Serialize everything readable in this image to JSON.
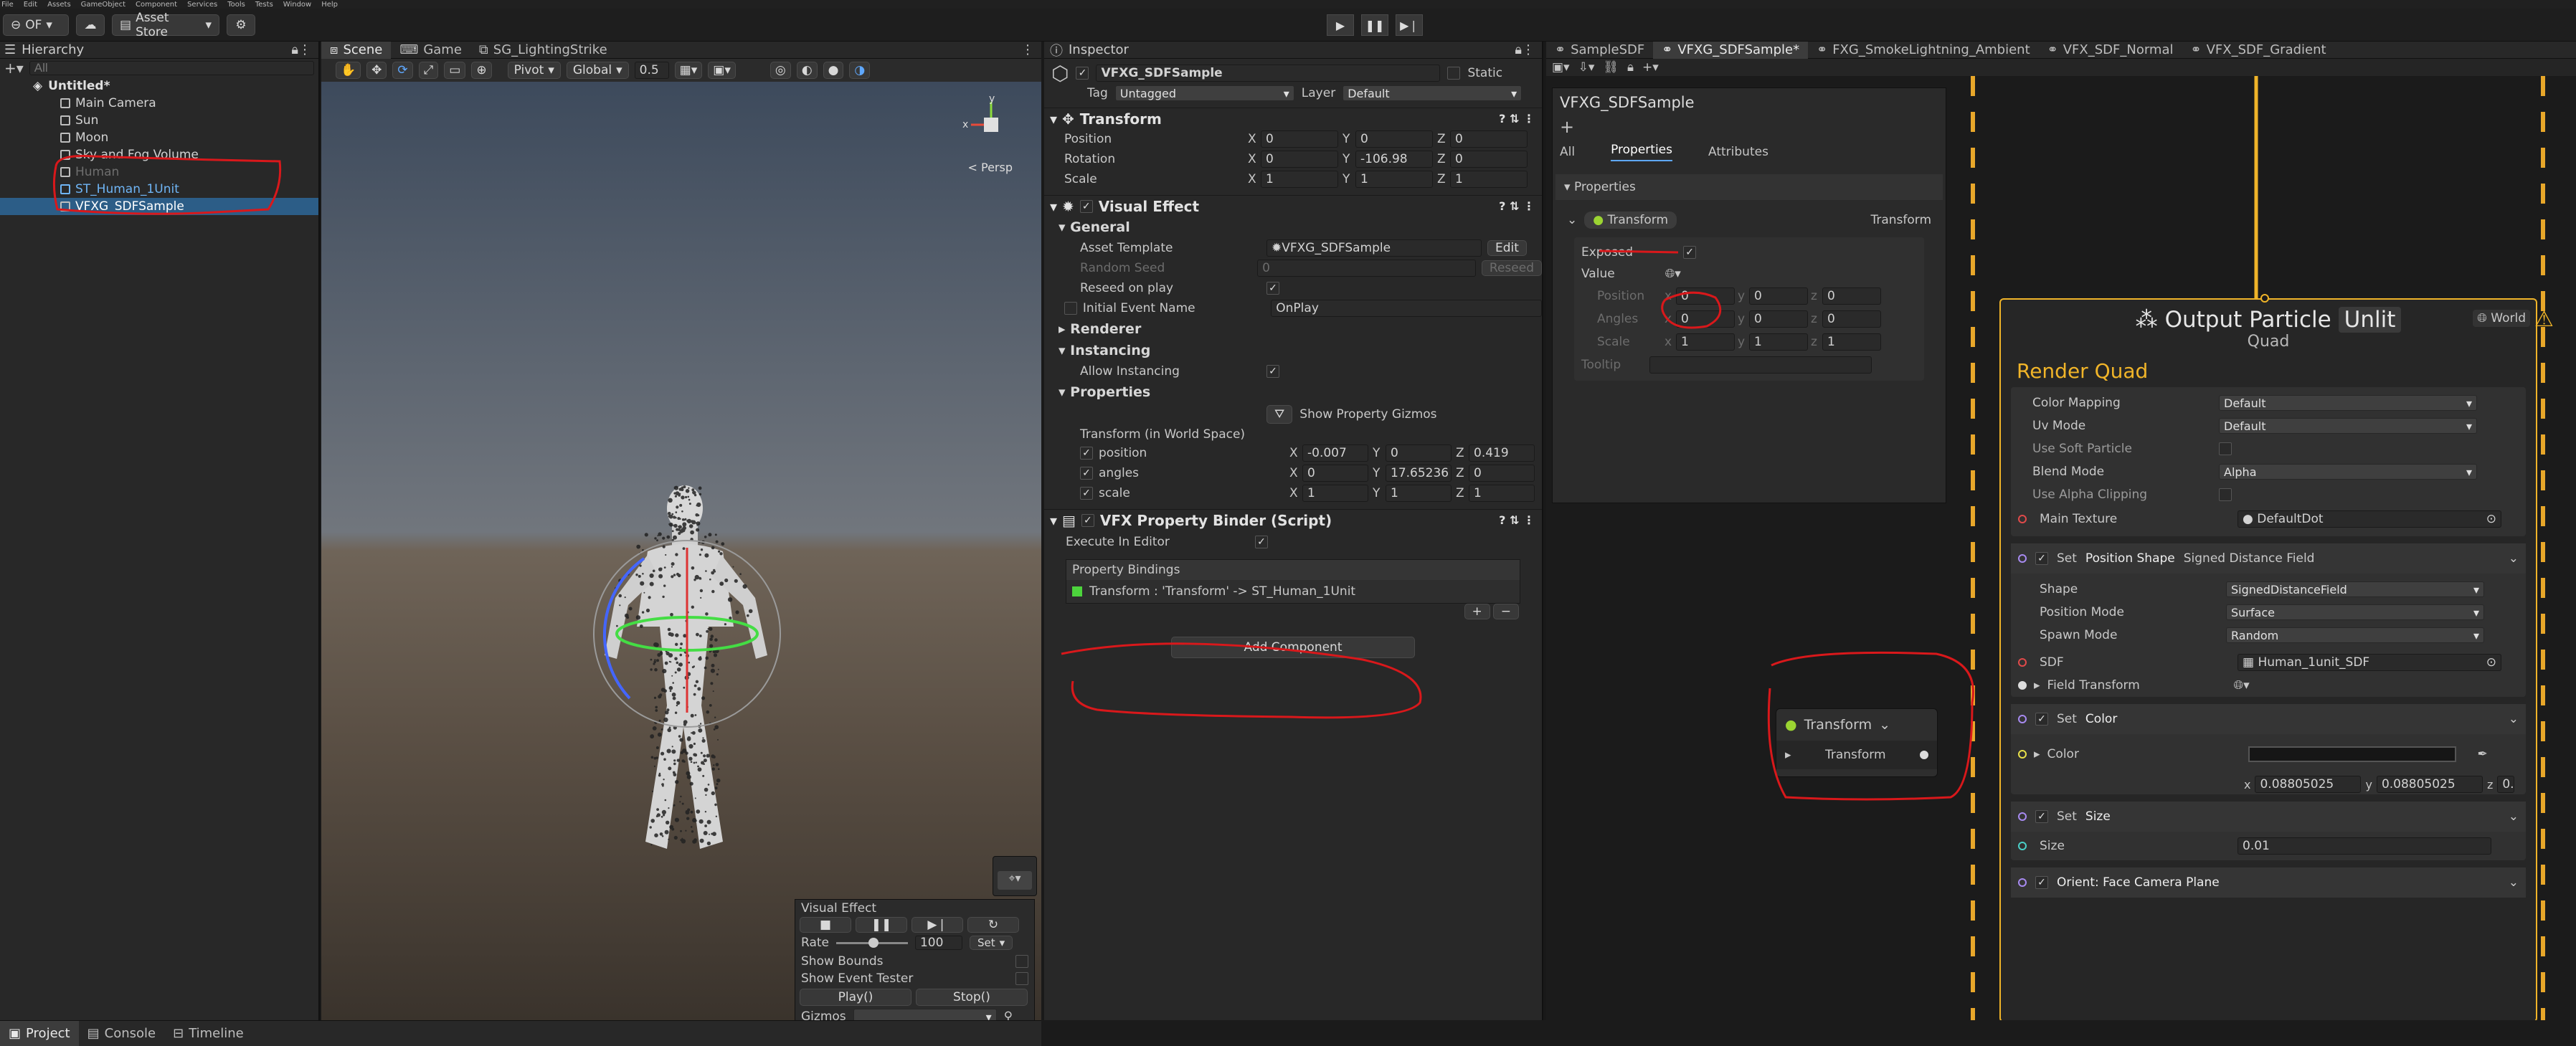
{
  "menu": [
    "File",
    "Edit",
    "Assets",
    "GameObject",
    "Component",
    "Services",
    "Tools",
    "Tests",
    "Window",
    "Help"
  ],
  "toolbar": {
    "account": "OF",
    "asset_store": "Asset Store"
  },
  "hierarchy": {
    "title": "Hierarchy",
    "search_placeholder": "All",
    "scene": "Untitled*",
    "items": [
      "Main Camera",
      "Sun",
      "Moon",
      "Sky and Fog Volume",
      "Human",
      "ST_Human_1Unit",
      "VFXG_SDFSample"
    ]
  },
  "scene_view": {
    "tabs": [
      "Scene",
      "Game",
      "SG_LightingStrike"
    ],
    "pivot": "Pivot",
    "global": "Global",
    "snap": "0.5",
    "persp": "< Persp",
    "gizmo_axes": {
      "x": "x",
      "y": "y"
    },
    "overlay": {
      "title": "Visual Effect",
      "rate_label": "Rate",
      "rate_value": "100",
      "set_label": "Set",
      "show_bounds": "Show Bounds",
      "show_event_tester": "Show Event Tester",
      "play": "Play()",
      "stop": "Stop()",
      "gizmos": "Gizmos"
    }
  },
  "inspector": {
    "title": "Inspector",
    "object": "VFXG_SDFSample",
    "static": "Static",
    "tag_label": "Tag",
    "tag": "Untagged",
    "layer_label": "Layer",
    "layer": "Default",
    "transform": {
      "title": "Transform",
      "position_label": "Position",
      "rotation_label": "Rotation",
      "scale_label": "Scale",
      "position": [
        "0",
        "0",
        "0"
      ],
      "rotation": [
        "0",
        "-106.98",
        "0"
      ],
      "scale": [
        "1",
        "1",
        "1"
      ]
    },
    "visual_effect": {
      "title": "Visual Effect",
      "general": "General",
      "asset_template_label": "Asset Template",
      "asset_template": "VFXG_SDFSample",
      "edit": "Edit",
      "random_seed_label": "Random Seed",
      "random_seed": "0",
      "reseed": "Reseed",
      "reseed_on_play": "Reseed on play",
      "initial_event_label": "Initial Event Name",
      "initial_event": "OnPlay",
      "renderer": "Renderer",
      "instancing": "Instancing",
      "allow_instancing": "Allow Instancing",
      "properties": "Properties",
      "show_gizmos": "Show Property Gizmos",
      "transform_space": "Transform (in World Space)",
      "position_label": "position",
      "angles_label": "angles",
      "scale_label": "scale",
      "position": [
        "-0.007",
        "0",
        "0.419"
      ],
      "angles": [
        "0",
        "17.65236",
        "0"
      ],
      "scale": [
        "1",
        "1",
        "1"
      ]
    },
    "binder": {
      "title": "VFX Property Binder (Script)",
      "execute_in_editor": "Execute In Editor",
      "bindings_label": "Property Bindings",
      "binding": "Transform : 'Transform' -> ST_Human_1Unit"
    },
    "add_component": "Add Component"
  },
  "vfx_tabs": [
    "SampleSDF",
    "VFXG_SDFSample*",
    "FXG_SmokeLightning_Ambient",
    "VFX_SDF_Normal",
    "VFX_SDF_Gradient"
  ],
  "blackboard": {
    "title": "VFXG_SDFSample",
    "tabs": [
      "All",
      "Properties",
      "Attributes"
    ],
    "section": "Properties",
    "prop_name": "Transform",
    "prop_type": "Transform",
    "exposed": "Exposed",
    "value": "Value",
    "position": "Position",
    "angles": "Angles",
    "scale": "Scale",
    "tooltip": "Tooltip",
    "pos": [
      "0",
      "0",
      "0"
    ],
    "ang": [
      "0",
      "0",
      "0"
    ],
    "scl": [
      "1",
      "1",
      "1"
    ]
  },
  "graph": {
    "transform_node": {
      "title": "Transform",
      "port": "Transform"
    },
    "output": {
      "title": "Output Particle",
      "unlit": "Unlit",
      "subtitle": "Quad",
      "space": "World",
      "render": "Render Quad",
      "color_mapping_label": "Color Mapping",
      "color_mapping": "Default",
      "uv_mode_label": "Uv Mode",
      "uv_mode": "Default",
      "soft_particle": "Use Soft Particle",
      "blend_mode_label": "Blend Mode",
      "blend_mode": "Alpha",
      "alpha_clipping": "Use Alpha Clipping",
      "main_texture_label": "Main Texture",
      "main_texture": "DefaultDot"
    },
    "block_position": {
      "set": "Set",
      "title": "Position Shape",
      "detail": "Signed Distance Field",
      "shape_label": "Shape",
      "shape": "SignedDistanceField",
      "position_mode_label": "Position Mode",
      "position_mode": "Surface",
      "spawn_mode_label": "Spawn Mode",
      "spawn_mode": "Random",
      "sdf_label": "SDF",
      "sdf": "Human_1unit_SDF",
      "field_transform": "Field Transform"
    },
    "block_color": {
      "set": "Set",
      "title": "Color",
      "color_label": "Color",
      "x": "0.08805025",
      "y": "0.08805025",
      "z": "0."
    },
    "block_size": {
      "set": "Set",
      "title": "Size",
      "size_label": "Size",
      "size": "0.01"
    },
    "block_orient": {
      "title": "Orient: Face Camera Plane"
    }
  },
  "bottom_tabs": [
    "Project",
    "Console",
    "Timeline"
  ],
  "colors": {
    "accent": "#f0b429",
    "select": "#2c5d87",
    "red_annotation": "#d9181b"
  }
}
